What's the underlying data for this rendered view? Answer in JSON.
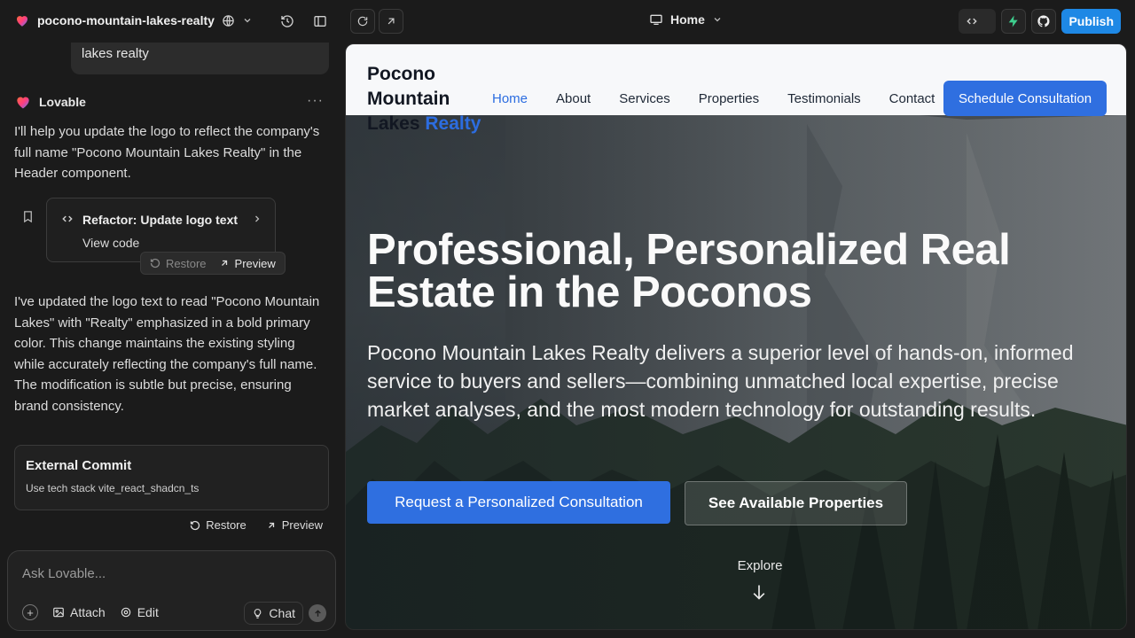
{
  "topbar": {
    "project_name": "pocono-mountain-lakes-realty",
    "route": "Home",
    "publish_label": "Publish"
  },
  "chat": {
    "user_message_tail": "lakes realty",
    "assistant_name": "Lovable",
    "message_1": "I'll help you update the logo to reflect the company's full name \"Pocono Mountain Lakes Realty\" in the Header component.",
    "card": {
      "title": "Refactor: Update logo text",
      "view_code": "View code",
      "restore": "Restore",
      "preview": "Preview"
    },
    "message_2": "I've updated the logo text to read \"Pocono Mountain Lakes\" with \"Realty\" emphasized in a bold primary color. This change maintains the existing styling while accurately reflecting the company's full name. The modification is subtle but precise, ensuring brand consistency.",
    "commit": {
      "title": "External Commit",
      "subtitle": "Use tech stack vite_react_shadcn_ts",
      "restore": "Restore",
      "preview": "Preview"
    },
    "composer": {
      "placeholder": "Ask Lovable...",
      "attach": "Attach",
      "edit": "Edit",
      "chat": "Chat"
    }
  },
  "site": {
    "logo_line1": "Pocono",
    "logo_line2": "Mountain",
    "logo_line3_main": "Lakes",
    "logo_line3_accent": "Realty",
    "nav": [
      "Home",
      "About",
      "Services",
      "Properties",
      "Testimonials",
      "Contact"
    ],
    "cta": "Schedule Consultation",
    "headline": "Professional, Personalized Real Estate in the Poconos",
    "lede": "Pocono Mountain Lakes Realty delivers a superior level of hands-on, informed service to buyers and sellers—combining unmatched local expertise, precise market analyses, and the most modern technology for outstanding results.",
    "btn_primary": "Request a Personalized Consultation",
    "btn_secondary": "See Available Properties",
    "explore": "Explore"
  },
  "colors": {
    "accent": "#2f6fe0",
    "publish": "#1e88e5",
    "panel_bg": "#1b1b1b"
  }
}
